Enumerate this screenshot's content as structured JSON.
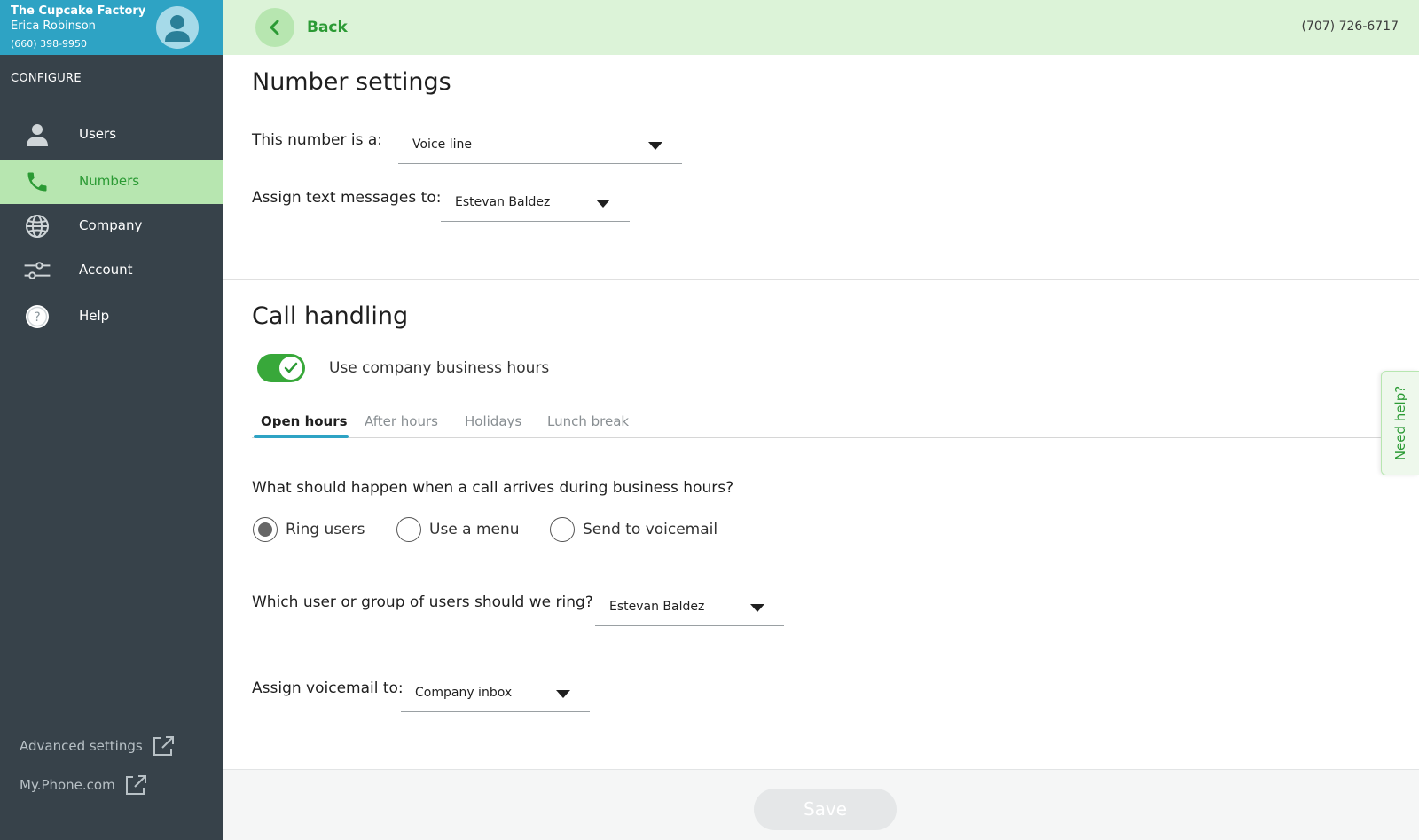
{
  "account": {
    "company": "The Cupcake Factory",
    "user": "Erica Robinson",
    "phone": "(660) 398-9950"
  },
  "sidebar": {
    "section_label": "CONFIGURE",
    "items": [
      {
        "label": "Users",
        "icon": "user-icon",
        "active": false
      },
      {
        "label": "Numbers",
        "icon": "phone-icon",
        "active": true
      },
      {
        "label": "Company",
        "icon": "globe-icon",
        "active": false
      },
      {
        "label": "Account",
        "icon": "sliders-icon",
        "active": false
      },
      {
        "label": "Help",
        "icon": "help-icon",
        "active": false
      }
    ],
    "links": [
      {
        "label": "Advanced settings",
        "icon": "external-link-icon"
      },
      {
        "label": "My.Phone.com",
        "icon": "external-link-icon"
      }
    ]
  },
  "topbar": {
    "back_label": "Back",
    "phone": "(707) 726-6717"
  },
  "number_settings": {
    "title": "Number settings",
    "type_label": "This number is a:",
    "type_value": "Voice line",
    "texts_label": "Assign text messages to:",
    "texts_value": "Estevan Baldez"
  },
  "call_handling": {
    "title": "Call handling",
    "toggle_label": "Use company business hours",
    "toggle_on": true,
    "tabs": [
      "Open hours",
      "After hours",
      "Holidays",
      "Lunch break"
    ],
    "active_tab": "Open hours",
    "question": "What should happen when a call arrives during business hours?",
    "options": [
      "Ring users",
      "Use a menu",
      "Send to voicemail"
    ],
    "selected_option": "Ring users",
    "ring_label": "Which user or group of users should we ring?",
    "ring_value": "Estevan Baldez",
    "voicemail_label": "Assign voicemail to:",
    "voicemail_value": "Company inbox"
  },
  "need_help": "Need help?",
  "footer": {
    "save_label": "Save"
  },
  "colors": {
    "sidebar_bg": "#37424a",
    "account_header_bg": "#2ea3c4",
    "active_green": "#2b9a34",
    "active_bg": "#b7e6b0",
    "topbar_bg": "#dcf3d8",
    "tab_underline": "#2ea3c4"
  }
}
